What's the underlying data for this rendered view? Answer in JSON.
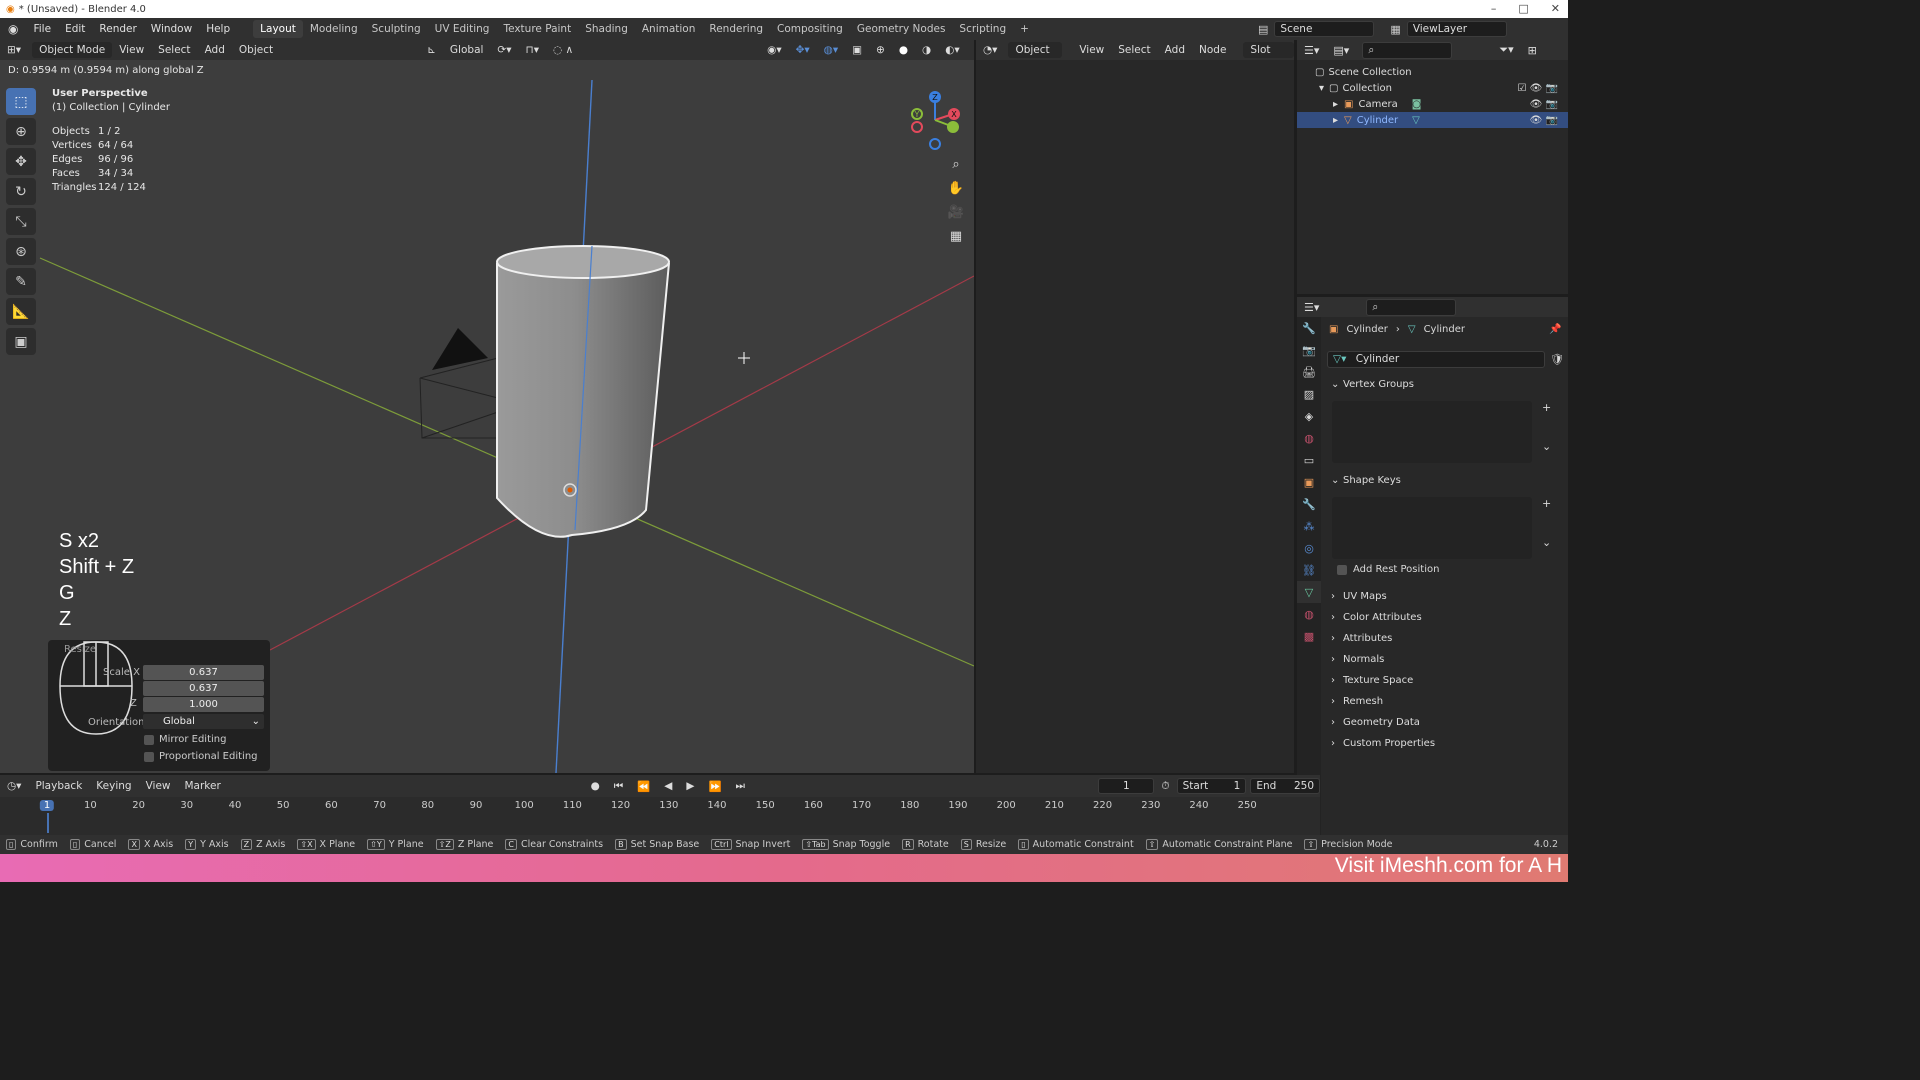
{
  "window": {
    "title": "* (Unsaved) - Blender 4.0",
    "controls": [
      "–",
      "□",
      "✕"
    ]
  },
  "menu": [
    "File",
    "Edit",
    "Render",
    "Window",
    "Help"
  ],
  "workspaces": [
    "Layout",
    "Modeling",
    "Sculpting",
    "UV Editing",
    "Texture Paint",
    "Shading",
    "Animation",
    "Rendering",
    "Compositing",
    "Geometry Nodes",
    "Scripting"
  ],
  "active_workspace": "Layout",
  "scene": {
    "scene_name": "Scene",
    "view_layer": "ViewLayer"
  },
  "viewport": {
    "mode": "Object Mode",
    "header_menus": [
      "View",
      "Select",
      "Add",
      "Object"
    ],
    "transform_orientation": "Global",
    "status_message": "D: 0.9594 m (0.9594 m) along global Z",
    "perspective": "User Perspective",
    "collection_line": "(1) Collection | Cylinder",
    "stats": [
      {
        "label": "Objects",
        "value": "1 / 2"
      },
      {
        "label": "Vertices",
        "value": "64 / 64"
      },
      {
        "label": "Edges",
        "value": "96 / 96"
      },
      {
        "label": "Faces",
        "value": "34 / 34"
      },
      {
        "label": "Triangles",
        "value": "124 / 124"
      }
    ],
    "key_overlay": [
      "S x2",
      "Shift + Z",
      "G",
      "Z"
    ],
    "gizmo_axes": {
      "x": "X",
      "y": "Y",
      "z": "Z"
    },
    "colors": {
      "x_axis": "#e34a5c",
      "y_axis": "#8bbd3a",
      "z_axis": "#3a7fe0",
      "selection": "#4772b3"
    }
  },
  "operator_panel": {
    "title": "Resize",
    "scale_label": "Scale X",
    "z_label": "Z",
    "scale_values": [
      "0.637",
      "0.637",
      "1.000"
    ],
    "orientation_label": "Orientation",
    "orientation_value": "Global",
    "mirror_editing": "Mirror Editing",
    "proportional_editing": "Proportional Editing"
  },
  "node_editor": {
    "type": "Object",
    "menus": [
      "View",
      "Select",
      "Add",
      "Node"
    ],
    "slot": "Slot"
  },
  "outliner": {
    "root": "Scene Collection",
    "items": [
      {
        "name": "Collection"
      },
      {
        "name": "Camera"
      },
      {
        "name": "Cylinder"
      }
    ]
  },
  "properties": {
    "breadcrumb": [
      "Cylinder",
      "Cylinder"
    ],
    "mesh_name": "Cylinder",
    "panels": {
      "vertex_groups": "Vertex Groups",
      "shape_keys": "Shape Keys",
      "add_rest_position": "Add Rest Position",
      "uv_maps": "UV Maps",
      "color_attributes": "Color Attributes",
      "attributes": "Attributes",
      "normals": "Normals",
      "texture_space": "Texture Space",
      "remesh": "Remesh",
      "geometry_data": "Geometry Data",
      "custom_properties": "Custom Properties"
    }
  },
  "timeline": {
    "menus": [
      "Playback",
      "Keying",
      "View",
      "Marker"
    ],
    "current_frame": "1",
    "start_label": "Start",
    "start": "1",
    "end_label": "End",
    "end": "250",
    "ticks": [
      "1",
      "10",
      "20",
      "30",
      "40",
      "50",
      "60",
      "70",
      "80",
      "90",
      "100",
      "110",
      "120",
      "130",
      "140",
      "150",
      "160",
      "170",
      "180",
      "190",
      "200",
      "210",
      "220",
      "230",
      "240",
      "250"
    ]
  },
  "statusbar": {
    "items": [
      {
        "key": "",
        "label": "Confirm"
      },
      {
        "key": "",
        "label": "Cancel"
      },
      {
        "key": "X",
        "label": "X Axis"
      },
      {
        "key": "Y",
        "label": "Y Axis"
      },
      {
        "key": "Z",
        "label": "Z Axis"
      },
      {
        "key": "⇧X",
        "label": "X Plane"
      },
      {
        "key": "⇧Y",
        "label": "Y Plane"
      },
      {
        "key": "⇧Z",
        "label": "Z Plane"
      },
      {
        "key": "C",
        "label": "Clear Constraints"
      },
      {
        "key": "B",
        "label": "Set Snap Base"
      },
      {
        "key": "Ctrl",
        "label": "Snap Invert"
      },
      {
        "key": "⇧Tab",
        "label": "Snap Toggle"
      },
      {
        "key": "R",
        "label": "Rotate"
      },
      {
        "key": "S",
        "label": "Resize"
      },
      {
        "key": "",
        "label": "Automatic Constraint"
      },
      {
        "key": "⇧",
        "label": "Automatic Constraint Plane"
      },
      {
        "key": "⇧",
        "label": "Precision Mode"
      }
    ],
    "version": "4.0.2"
  },
  "banner": {
    "text": "Visit iMeshh.com for A H"
  }
}
